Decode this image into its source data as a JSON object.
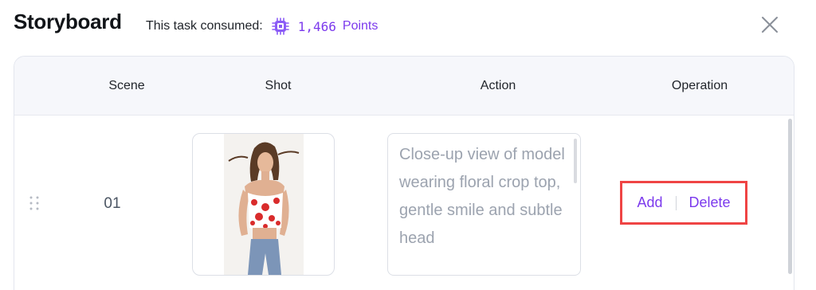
{
  "header": {
    "title": "Storyboard",
    "consumed_label": "This task consumed:",
    "points_value": "1,466",
    "points_unit": "Points",
    "accent_color": "#7c3aed",
    "icons": {
      "points": "chip-coin-icon",
      "close": "close-icon"
    }
  },
  "table": {
    "columns": [
      "Scene",
      "Shot",
      "Action",
      "Operation"
    ],
    "rows": [
      {
        "scene": "01",
        "shot_icon": "model-photo",
        "action": "Close-up view of model wearing floral crop top, gentle smile and subtle head",
        "operations": {
          "add": "Add",
          "delete": "Delete"
        }
      }
    ]
  },
  "highlight_color": "#ef4444"
}
